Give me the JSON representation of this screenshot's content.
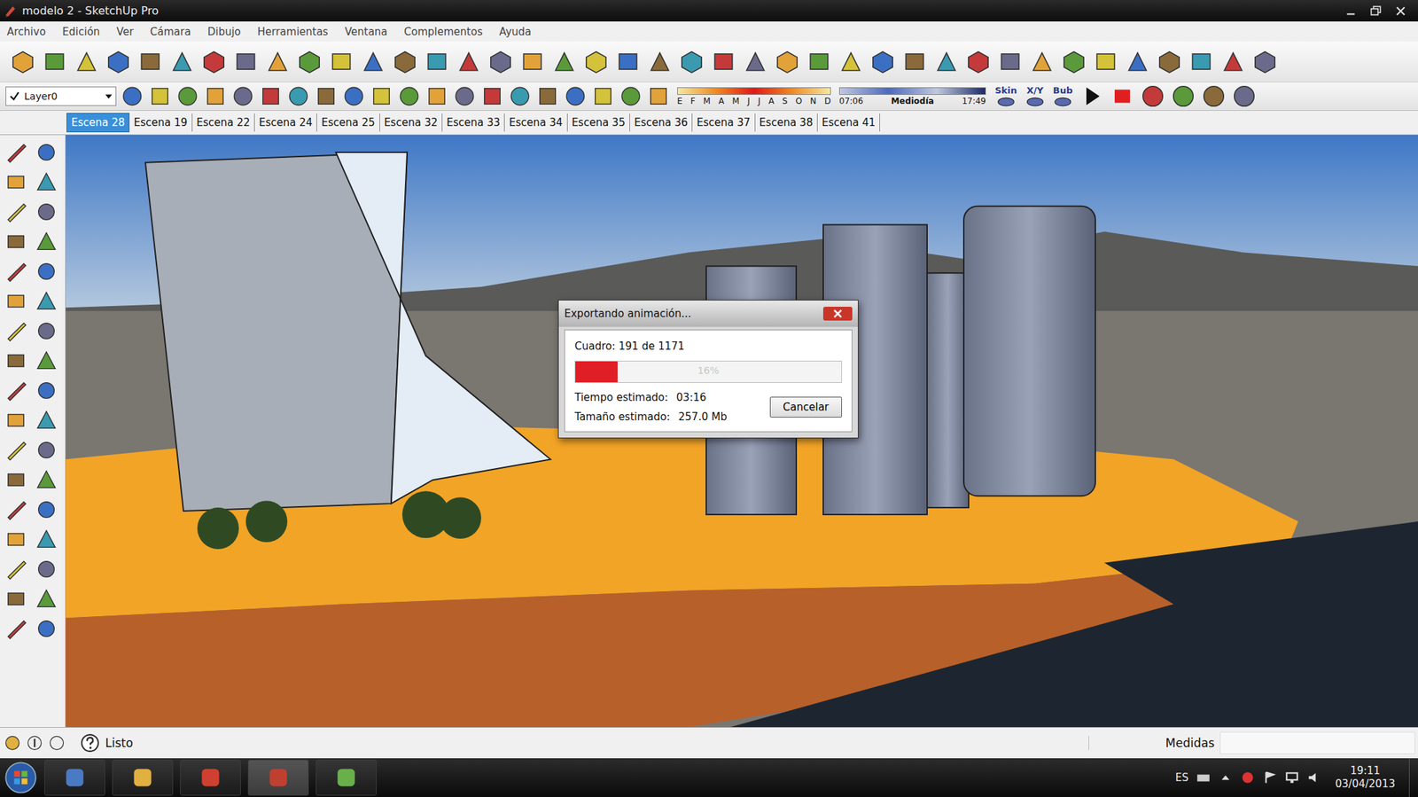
{
  "window": {
    "title": "modelo 2 - SketchUp Pro"
  },
  "menu": [
    "Archivo",
    "Edición",
    "Ver",
    "Cámara",
    "Dibujo",
    "Herramientas",
    "Ventana",
    "Complementos",
    "Ayuda"
  ],
  "layer": {
    "name": "Layer0",
    "checked": true
  },
  "shadow_settings": {
    "months": [
      "E",
      "F",
      "M",
      "A",
      "M",
      "J",
      "J",
      "A",
      "S",
      "O",
      "N",
      "D"
    ],
    "start_time": "07:06",
    "midday": "Mediodía",
    "end_time": "17:49"
  },
  "toolbar_labels": [
    "Skin",
    "X/Y",
    "Bub"
  ],
  "tabs": [
    {
      "label": "Escena 28",
      "selected": true
    },
    {
      "label": "Escena 19",
      "selected": false
    },
    {
      "label": "Escena 22",
      "selected": false
    },
    {
      "label": "Escena 24",
      "selected": false
    },
    {
      "label": "Escena 25",
      "selected": false
    },
    {
      "label": "Escena 32",
      "selected": false
    },
    {
      "label": "Escena 33",
      "selected": false
    },
    {
      "label": "Escena 34",
      "selected": false
    },
    {
      "label": "Escena 35",
      "selected": false
    },
    {
      "label": "Escena 36",
      "selected": false
    },
    {
      "label": "Escena 37",
      "selected": false
    },
    {
      "label": "Escena 38",
      "selected": false
    },
    {
      "label": "Escena 41",
      "selected": false
    }
  ],
  "dialog": {
    "title": "Exportando animación...",
    "frame": "Cuadro: 191 de 1171",
    "progress": {
      "level": 0.16,
      "reading": "16%"
    },
    "time_label": "Tiempo estimado:",
    "time": "03:16",
    "size_label": "Tamaño estimado:",
    "size": "257.0 Mb",
    "cancel": "Cancelar"
  },
  "status_bar": {
    "text": "Listo",
    "measurements": "Medidas"
  },
  "taskbar": {
    "language": "ES",
    "time": "19:11",
    "date": "03/04/2013"
  }
}
